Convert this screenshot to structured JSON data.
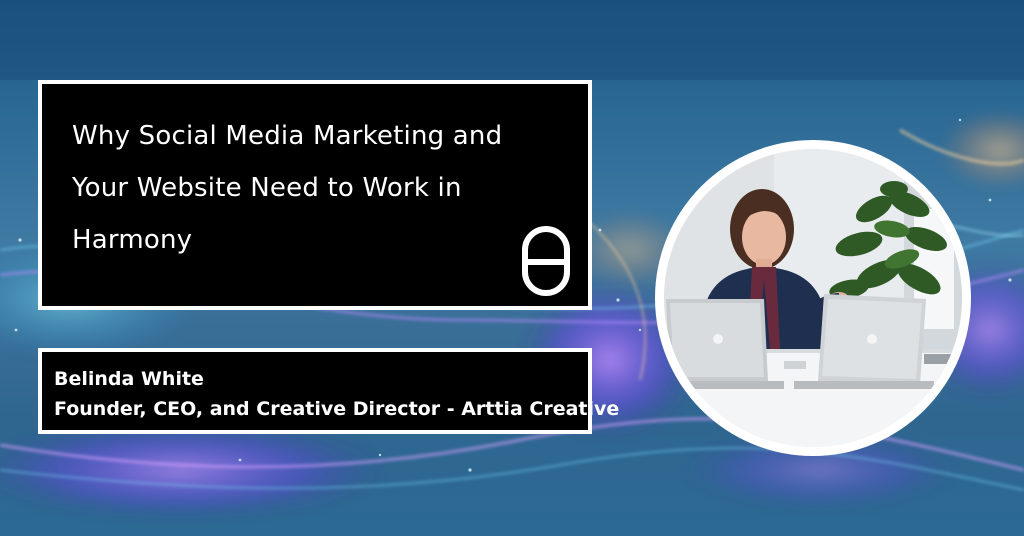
{
  "title": {
    "line1": "Why Social Media Marketing and",
    "line2": "Your Website Need to Work in",
    "line3": "Harmony"
  },
  "author": {
    "name": "Belinda White",
    "role": "Founder, CEO, and Creative Director - Arttia Creative"
  },
  "icons": {
    "brand": "brand-logo-icon"
  },
  "colors": {
    "background": "#2f6a94",
    "panel": "#000000",
    "border": "#ffffff",
    "glow_purple": "#9a5cff",
    "glow_cyan": "#3fd8ff",
    "glow_orange": "#ffb070"
  }
}
